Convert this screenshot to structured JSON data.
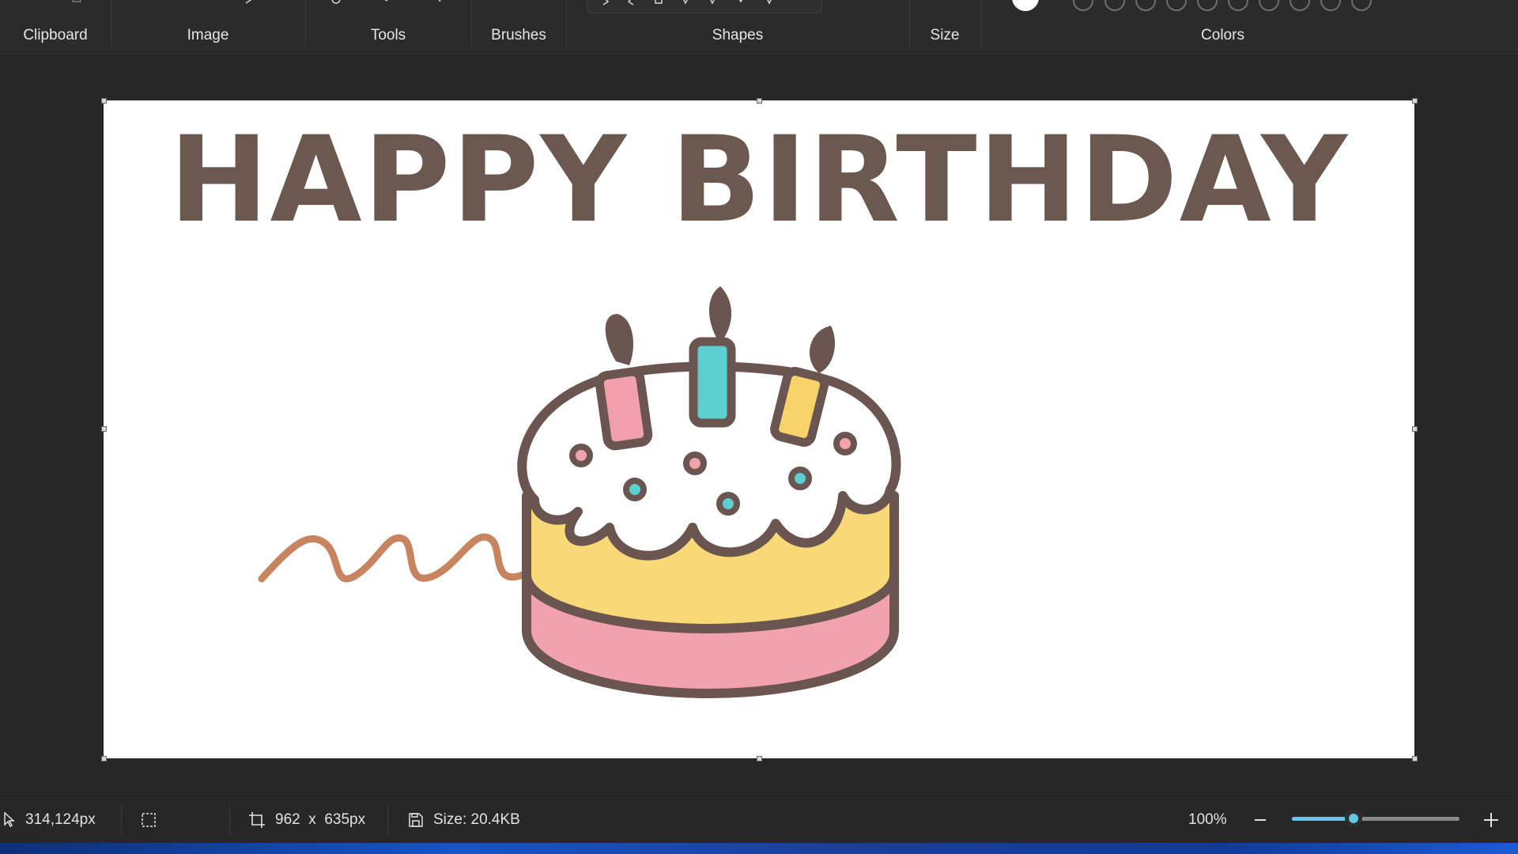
{
  "ribbon": {
    "groups": {
      "clipboard": "Clipboard",
      "image": "Image",
      "tools": "Tools",
      "brushes": "Brushes",
      "shapes": "Shapes",
      "size": "Size",
      "colors": "Colors"
    },
    "colors": {
      "primary": "#ffffff",
      "palette_slots": 10
    }
  },
  "canvas": {
    "title_text": "HAPPY BIRTHDAY",
    "title_color": "#6b584f",
    "drawing": {
      "subject": "birthday cake with three candles",
      "candle_colors": [
        "#f2a0ad",
        "#5ccfd0",
        "#f7d36a"
      ],
      "frosting_color": "#ffffff",
      "cake_layer_colors": [
        "#f9d877",
        "#f1a2ad"
      ],
      "outline_color": "#6a5550",
      "scribble_color": "#c7845e"
    }
  },
  "statusbar": {
    "cursor_position": "314,124px",
    "canvas_size": "962  x  635px",
    "file_size": "Size: 20.4KB",
    "zoom": "100%",
    "zoom_level": 0.37,
    "accent": "#62c6e8"
  }
}
